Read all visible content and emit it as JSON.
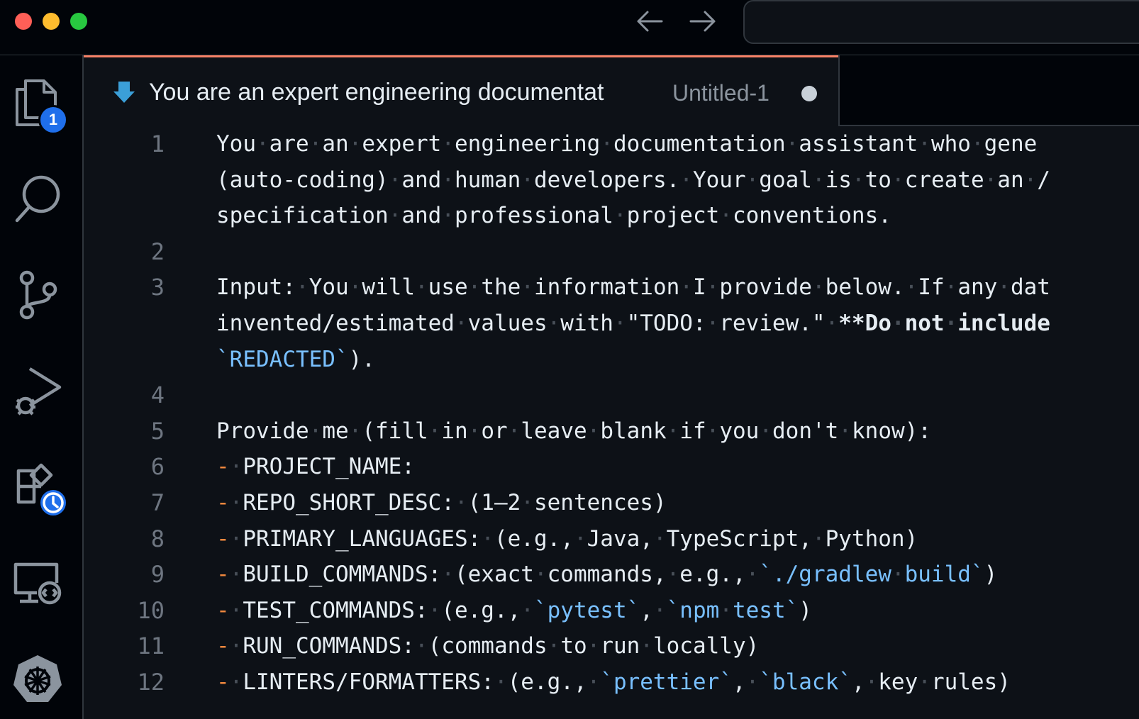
{
  "window": {
    "tab": {
      "title": "You are an expert engineering documentat",
      "description": "Untitled-1"
    }
  },
  "activity_bar": {
    "explorer_badge": "1"
  },
  "colors": {
    "accent": "#f78166",
    "badge": "#1f6feb",
    "code_span": "#79c0ff",
    "bullet": "#f0883e"
  },
  "icons": [
    "files-icon",
    "search-icon",
    "source-control-icon",
    "run-debug-icon",
    "extensions-icon",
    "remote-explorer-icon",
    "kubernetes-icon",
    "arrow-left-icon",
    "arrow-right-icon",
    "pin-icon"
  ],
  "editor": {
    "lines": [
      {
        "num": "1",
        "rows": [
          [
            {
              "t": "You are an expert engineering documentation assistant who gene"
            }
          ],
          [
            {
              "t": "(auto-coding) and human developers. Your goal is to create an /"
            }
          ],
          [
            {
              "t": "specification and professional project conventions."
            }
          ]
        ]
      },
      {
        "num": "2",
        "rows": [
          []
        ]
      },
      {
        "num": "3",
        "rows": [
          [
            {
              "t": "Input: You will use the information I provide below. If any dat"
            }
          ],
          [
            {
              "t": "invented/estimated values with \"TODO: review.\" "
            },
            {
              "t": "**Do not include",
              "k": "bold"
            }
          ],
          [
            {
              "t": "`REDACTED`",
              "k": "c"
            },
            {
              "t": ")."
            }
          ]
        ]
      },
      {
        "num": "4",
        "rows": [
          []
        ]
      },
      {
        "num": "5",
        "rows": [
          [
            {
              "t": "Provide me (fill in or leave blank if you don't know):"
            }
          ]
        ]
      },
      {
        "num": "6",
        "rows": [
          [
            {
              "t": "-",
              "k": "b"
            },
            {
              "t": " PROJECT_NAME:"
            }
          ]
        ]
      },
      {
        "num": "7",
        "rows": [
          [
            {
              "t": "-",
              "k": "b"
            },
            {
              "t": " REPO_SHORT_DESC: (1–2 sentences)"
            }
          ]
        ]
      },
      {
        "num": "8",
        "rows": [
          [
            {
              "t": "-",
              "k": "b"
            },
            {
              "t": " PRIMARY_LANGUAGES: (e.g., Java, TypeScript, Python)"
            }
          ]
        ]
      },
      {
        "num": "9",
        "rows": [
          [
            {
              "t": "-",
              "k": "b"
            },
            {
              "t": " BUILD_COMMANDS: (exact commands, e.g., "
            },
            {
              "t": "`./gradlew build`",
              "k": "c"
            },
            {
              "t": ")"
            }
          ]
        ]
      },
      {
        "num": "10",
        "rows": [
          [
            {
              "t": "-",
              "k": "b"
            },
            {
              "t": " TEST_COMMANDS: (e.g., "
            },
            {
              "t": "`pytest`",
              "k": "c"
            },
            {
              "t": ", "
            },
            {
              "t": "`npm test`",
              "k": "c"
            },
            {
              "t": ")"
            }
          ]
        ]
      },
      {
        "num": "11",
        "rows": [
          [
            {
              "t": "-",
              "k": "b"
            },
            {
              "t": " RUN_COMMANDS: (commands to run locally)"
            }
          ]
        ]
      },
      {
        "num": "12",
        "rows": [
          [
            {
              "t": "-",
              "k": "b"
            },
            {
              "t": " LINTERS/FORMATTERS: (e.g., "
            },
            {
              "t": "`prettier`",
              "k": "c"
            },
            {
              "t": ", "
            },
            {
              "t": "`black`",
              "k": "c"
            },
            {
              "t": ", key rules)"
            }
          ]
        ]
      }
    ]
  }
}
